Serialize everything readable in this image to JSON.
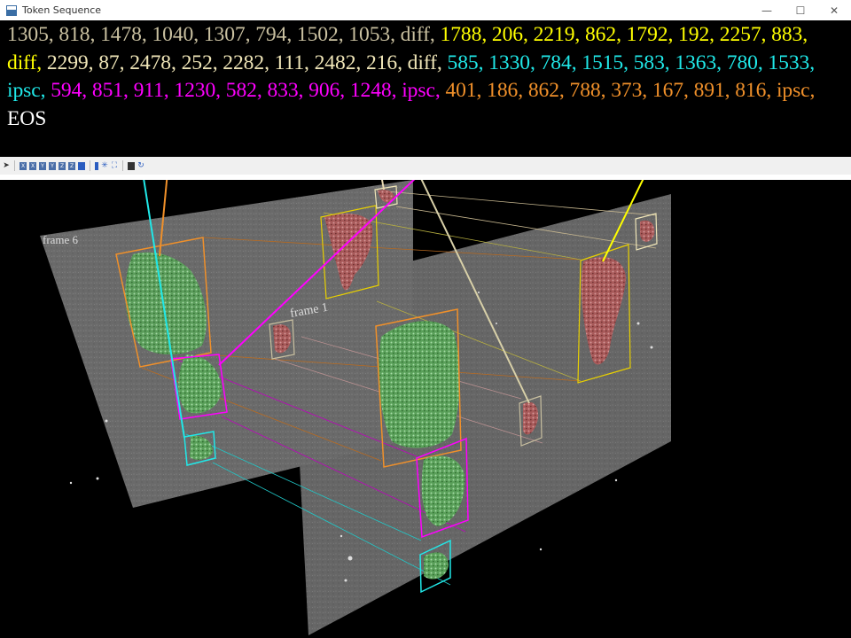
{
  "window": {
    "title": "Token Sequence",
    "minimize": "—",
    "maximize": "☐",
    "close": "✕"
  },
  "colors": {
    "gray": "#c9c0a0",
    "yellow": "#ffff00",
    "khaki": "#f0e6b8",
    "cyan": "#20e8e8",
    "magenta": "#ff00ff",
    "orange": "#f0902a",
    "white": "#ffffff"
  },
  "tokens": [
    {
      "text": "1305, 818, 1478, 1040, 1307, 794, 1502, 1053, diff,",
      "color": "gray"
    },
    {
      "text": " 1788, 206, 2219, 862, 1792, 192, 2257, 883, diff,",
      "color": "yellow"
    },
    {
      "text": " 2299, 87, 2478, 252, 2282, 111, 2482, 216, diff,",
      "color": "khaki"
    },
    {
      "text": " 585, 1330, 784, 1515, 583, 1363, 780, 1533, ipsc,",
      "color": "cyan"
    },
    {
      "text": " 594, 851, 911, 1230, 582, 833, 906, 1248, ipsc,",
      "color": "magenta"
    },
    {
      "text": " 401, 186, 862, 788, 373, 167, 891, 816, ipsc,",
      "color": "orange"
    },
    {
      "text": " EOS",
      "color": "white"
    }
  ],
  "toolbar": {
    "icons": [
      "pointer-icon",
      "view-x-icon",
      "view-x-neg-icon",
      "view-y-icon",
      "view-y-neg-icon",
      "view-z-icon",
      "view-z-neg-icon",
      "cube-icon",
      "sep",
      "bar-icon",
      "axes-icon",
      "fit-icon",
      "sep",
      "save-icon",
      "refresh-icon"
    ]
  },
  "scene": {
    "frame_back_label": "frame 6",
    "frame_front_label": "frame 1"
  }
}
